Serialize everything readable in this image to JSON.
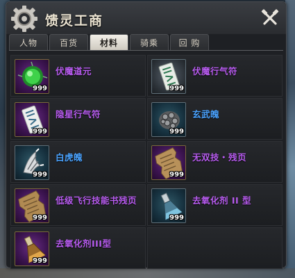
{
  "window": {
    "title": "馈灵工商",
    "icon": "gear-icon",
    "close_icon": "crossed-tools-icon"
  },
  "tabs": [
    {
      "label": "人物",
      "active": false
    },
    {
      "label": "百货",
      "active": false
    },
    {
      "label": "材料",
      "active": true
    },
    {
      "label": "骑乘",
      "active": false
    },
    {
      "label": "回 购",
      "active": false
    }
  ],
  "colors": {
    "purple_name": "#b85cf0",
    "blue_name": "#4aa3ff",
    "active_tab": "#f2efe8"
  },
  "items": [
    {
      "name": "伏魔道元",
      "qty": "999",
      "icon": "green-orb-icon",
      "color": "#b85cf0"
    },
    {
      "name": "伏魔行气符",
      "qty": "999",
      "icon": "talisman-scroll-icon",
      "color": "#b85cf0"
    },
    {
      "name": "隐星行气符",
      "qty": "999",
      "icon": "talisman-scroll-icon",
      "color": "#b85cf0"
    },
    {
      "name": "玄武魄",
      "qty": "999",
      "icon": "stone-shell-icon",
      "color": "#4aa3ff"
    },
    {
      "name": "白虎魄",
      "qty": "999",
      "icon": "tiger-claw-icon",
      "color": "#4aa3ff"
    },
    {
      "name": "无双技・残页",
      "qty": "999",
      "icon": "torn-page-icon",
      "color": "#b85cf0"
    },
    {
      "name": "低级飞行技能书残页",
      "qty": "999",
      "icon": "torn-page-icon",
      "color": "#b85cf0"
    },
    {
      "name": "去氧化剂 II 型",
      "qty": "999",
      "icon": "flask-icon",
      "color": "#b85cf0"
    },
    {
      "name": "去氧化剂III型",
      "qty": "999",
      "icon": "flask-icon",
      "color": "#b85cf0"
    }
  ]
}
